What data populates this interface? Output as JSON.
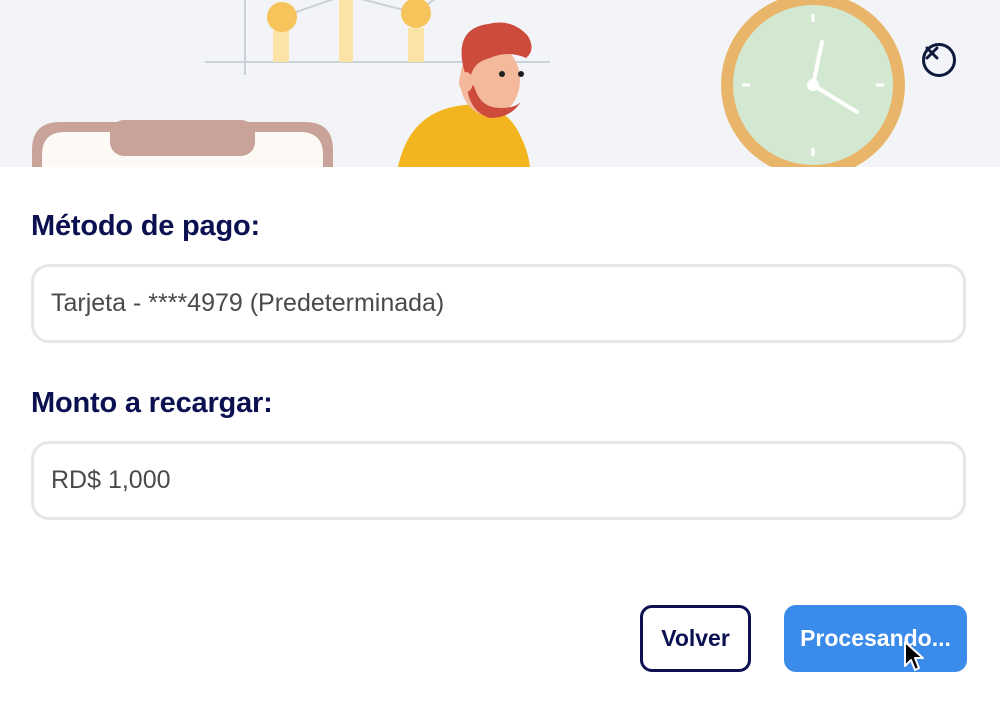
{
  "form": {
    "method_label": "Método de pago:",
    "method_value": "Tarjeta - ****4979 (Predeterminada)",
    "amount_label": "Monto a recargar:",
    "amount_value": "RD$ 1,000"
  },
  "actions": {
    "back_label": "Volver",
    "process_label": "Procesando..."
  },
  "colors": {
    "heading": "#0b1150",
    "primary": "#3b8beb",
    "field_border": "#e6e6e6",
    "hero_background": "#f2f4f7"
  },
  "icons": {
    "close": "close-icon",
    "cursor": "mouse-cursor-icon"
  }
}
